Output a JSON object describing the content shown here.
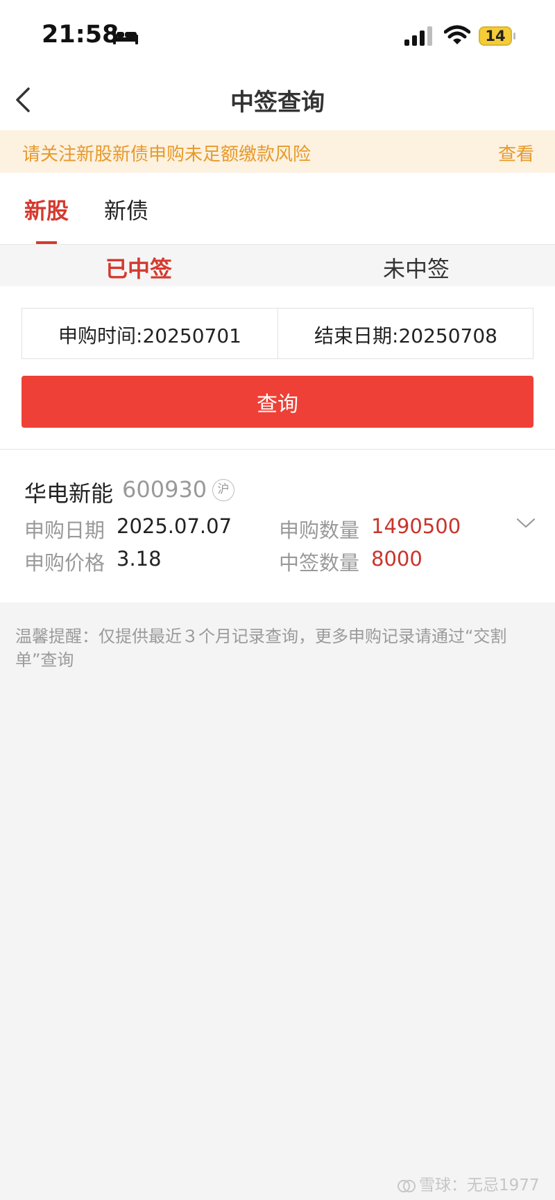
{
  "status_bar": {
    "time": "21:58",
    "battery_level": "14",
    "battery_color": "#f5cc38"
  },
  "nav": {
    "title": "中签查询"
  },
  "notice": {
    "text": "请关注新股新债申购未足额缴款风险",
    "link": "查看"
  },
  "tabs": [
    {
      "label": "新股",
      "active": true
    },
    {
      "label": "新债",
      "active": false
    }
  ],
  "segments": [
    {
      "label": "已中签",
      "active": true
    },
    {
      "label": "未中签",
      "active": false
    }
  ],
  "query": {
    "start_date": "申购时间:20250701",
    "end_date": "结束日期:20250708",
    "button_label": "查询"
  },
  "result": {
    "name": "华电新能",
    "code": "600930",
    "market": "沪",
    "fields": {
      "subscribe_date_label": "申购日期",
      "subscribe_date_value": "2025.07.07",
      "subscribe_price_label": "申购价格",
      "subscribe_price_value": "3.18",
      "subscribe_qty_label": "申购数量",
      "subscribe_qty_value": "1490500",
      "won_qty_label": "中签数量",
      "won_qty_value": "8000"
    }
  },
  "tip": "温馨提醒：仅提供最近３个月记录查询，更多申购记录请通过“交割单”查询",
  "watermark": {
    "text": "雪球：无忌1977"
  },
  "colors": {
    "accent": "#d43a2f",
    "button": "#ee4036",
    "notice_text": "#e69a2a",
    "notice_bg": "#fdf1e0"
  }
}
